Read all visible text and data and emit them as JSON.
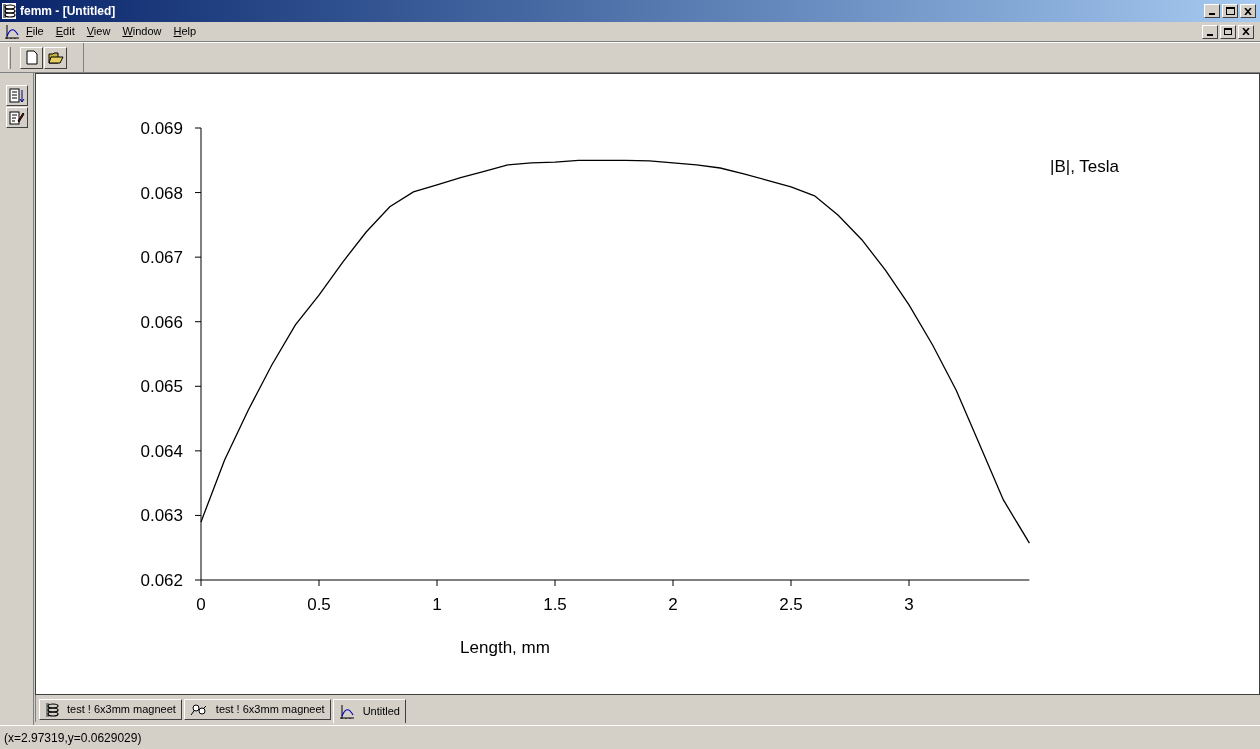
{
  "window": {
    "title": "femm - [Untitled]"
  },
  "menu": [
    {
      "label": "File"
    },
    {
      "label": "Edit"
    },
    {
      "label": "View"
    },
    {
      "label": "Window"
    },
    {
      "label": "Help"
    }
  ],
  "chart_data": {
    "type": "line",
    "xlabel": "Length, mm",
    "xlim": [
      0,
      3.51
    ],
    "ylim": [
      0.062,
      0.069
    ],
    "xticks": [
      {
        "value": 0,
        "label": "0"
      },
      {
        "value": 0.5,
        "label": "0.5"
      },
      {
        "value": 1,
        "label": "1"
      },
      {
        "value": 1.5,
        "label": "1.5"
      },
      {
        "value": 2,
        "label": "2"
      },
      {
        "value": 2.5,
        "label": "2.5"
      },
      {
        "value": 3,
        "label": "3"
      }
    ],
    "yticks": [
      {
        "value": 0.062,
        "label": "0.062"
      },
      {
        "value": 0.063,
        "label": "0.063"
      },
      {
        "value": 0.064,
        "label": "0.064"
      },
      {
        "value": 0.065,
        "label": "0.065"
      },
      {
        "value": 0.066,
        "label": "0.066"
      },
      {
        "value": 0.067,
        "label": "0.067"
      },
      {
        "value": 0.068,
        "label": "0.068"
      },
      {
        "value": 0.069,
        "label": "0.069"
      }
    ],
    "x": [
      0,
      0.1,
      0.2,
      0.3,
      0.4,
      0.5,
      0.6,
      0.7,
      0.8,
      0.9,
      1.0,
      1.1,
      1.2,
      1.3,
      1.4,
      1.5,
      1.6,
      1.7,
      1.8,
      1.9,
      2.0,
      2.1,
      2.2,
      2.3,
      2.4,
      2.5,
      2.6,
      2.7,
      2.8,
      2.9,
      3.0,
      3.1,
      3.2,
      3.3,
      3.4,
      3.51
    ],
    "series": [
      {
        "name": "|B|, Tesla",
        "color": "#000000",
        "values": [
          0.0629,
          0.06386,
          0.06463,
          0.06533,
          0.06595,
          0.06641,
          0.06692,
          0.06739,
          0.06778,
          0.06801,
          0.06812,
          0.06823,
          0.06833,
          0.06843,
          0.06846,
          0.06847,
          0.0685,
          0.0685,
          0.0685,
          0.06849,
          0.06846,
          0.06843,
          0.06838,
          0.06829,
          0.06819,
          0.06809,
          0.06795,
          0.06765,
          0.06727,
          0.0668,
          0.06626,
          0.06564,
          0.06494,
          0.06409,
          0.06324,
          0.06257
        ]
      }
    ]
  },
  "tabs": [
    {
      "label": "test ! 6x3mm magneet",
      "kind": "magnetics",
      "selected": false
    },
    {
      "label": "test ! 6x3mm magneet",
      "kind": "output",
      "selected": false
    },
    {
      "label": "Untitled",
      "kind": "plot",
      "selected": true
    }
  ],
  "status_bar": "(x=2.97319,y=0.0629029)"
}
